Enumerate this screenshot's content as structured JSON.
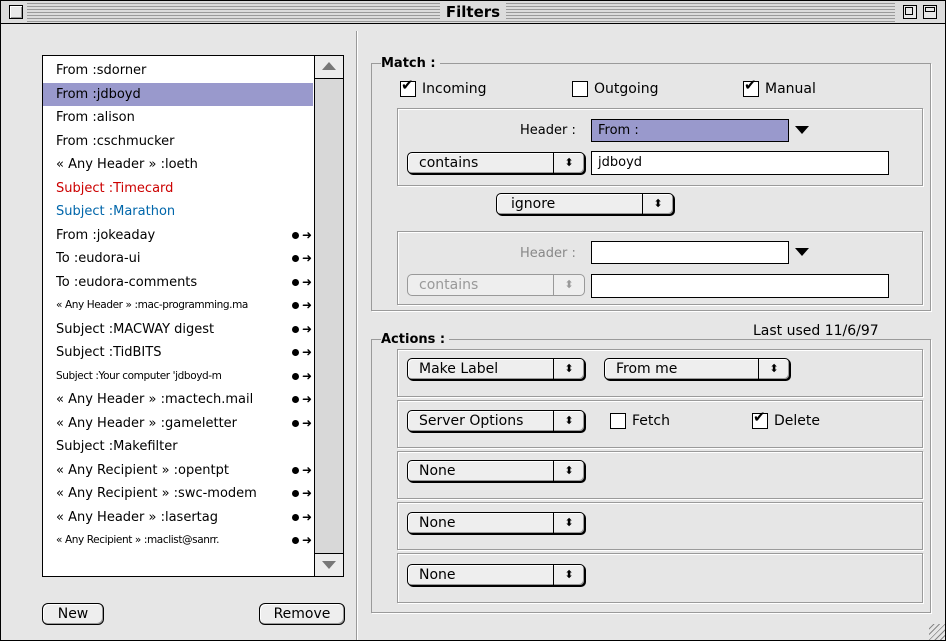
{
  "window": {
    "title": "Filters"
  },
  "filter_list": [
    {
      "label": "From :sdorner",
      "color": "#000000",
      "selected": false,
      "small": false,
      "actions": false
    },
    {
      "label": "From :jdboyd",
      "color": "#000000",
      "selected": true,
      "small": false,
      "actions": false
    },
    {
      "label": "From :alison",
      "color": "#000000",
      "selected": false,
      "small": false,
      "actions": false
    },
    {
      "label": "From :cschmucker",
      "color": "#000000",
      "selected": false,
      "small": false,
      "actions": false
    },
    {
      "label": "« Any Header » :loeth",
      "color": "#000000",
      "selected": false,
      "small": false,
      "actions": false
    },
    {
      "label": "Subject :Timecard",
      "color": "#cc0000",
      "selected": false,
      "small": false,
      "actions": false
    },
    {
      "label": "Subject :Marathon",
      "color": "#0066aa",
      "selected": false,
      "small": false,
      "actions": false
    },
    {
      "label": "From :jokeaday",
      "color": "#000000",
      "selected": false,
      "small": false,
      "actions": true
    },
    {
      "label": "To :eudora-ui",
      "color": "#000000",
      "selected": false,
      "small": false,
      "actions": true
    },
    {
      "label": "To :eudora-comments",
      "color": "#000000",
      "selected": false,
      "small": false,
      "actions": true
    },
    {
      "label": "« Any Header » :mac-programming.ma",
      "color": "#000000",
      "selected": false,
      "small": true,
      "actions": true
    },
    {
      "label": "Subject :MACWAY digest",
      "color": "#000000",
      "selected": false,
      "small": false,
      "actions": true
    },
    {
      "label": "Subject :TidBITS",
      "color": "#000000",
      "selected": false,
      "small": false,
      "actions": true
    },
    {
      "label": "Subject :Your computer 'jdboyd-m",
      "color": "#000000",
      "selected": false,
      "small": true,
      "actions": true
    },
    {
      "label": "« Any Header » :mactech.mail",
      "color": "#000000",
      "selected": false,
      "small": false,
      "actions": true
    },
    {
      "label": "« Any Header » :gameletter",
      "color": "#000000",
      "selected": false,
      "small": false,
      "actions": true
    },
    {
      "label": "Subject :Makefilter",
      "color": "#000000",
      "selected": false,
      "small": false,
      "actions": false
    },
    {
      "label": "« Any Recipient » :opentpt",
      "color": "#000000",
      "selected": false,
      "small": false,
      "actions": true
    },
    {
      "label": "« Any Recipient » :swc-modem",
      "color": "#000000",
      "selected": false,
      "small": false,
      "actions": true
    },
    {
      "label": "« Any Header » :lasertag",
      "color": "#000000",
      "selected": false,
      "small": false,
      "actions": true
    },
    {
      "label": "« Any Recipient » :maclist@sanrr.",
      "color": "#000000",
      "selected": false,
      "small": true,
      "actions": true
    }
  ],
  "buttons": {
    "new": "New",
    "remove": "Remove"
  },
  "match": {
    "title": "Match :",
    "incoming": {
      "label": "Incoming",
      "checked": true
    },
    "outgoing": {
      "label": "Outgoing",
      "checked": false
    },
    "manual": {
      "label": "Manual",
      "checked": true
    },
    "clause1": {
      "header_label": "Header :",
      "header_value": "From :",
      "verb": "contains",
      "value": "jdboyd"
    },
    "conjunction": "ignore",
    "clause2": {
      "header_label": "Header :",
      "header_value": "",
      "verb": "contains",
      "value": ""
    }
  },
  "actions": {
    "title": "Actions :",
    "last_used": "Last used 11/6/97",
    "action1": {
      "type": "Make Label",
      "option": "From me"
    },
    "action2": {
      "type": "Server Options",
      "fetch": {
        "label": "Fetch",
        "checked": false
      },
      "delete": {
        "label": "Delete",
        "checked": true
      }
    },
    "action3": {
      "type": "None"
    },
    "action4": {
      "type": "None"
    },
    "action5": {
      "type": "None"
    }
  },
  "symbols": {
    "check": "✔",
    "popup_arrow": "⬍",
    "action_arrow": "➜"
  }
}
